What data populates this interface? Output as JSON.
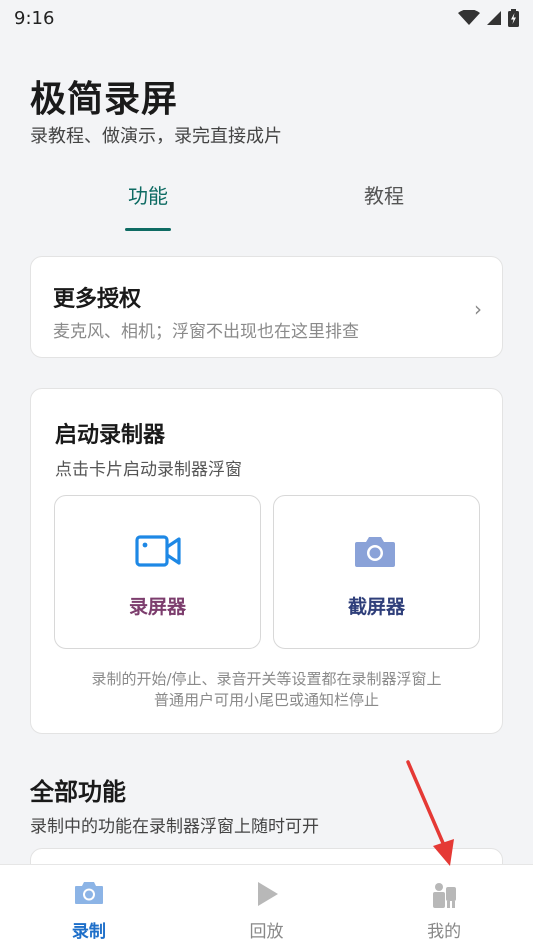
{
  "status_bar": {
    "time": "9:16"
  },
  "header": {
    "title": "极简录屏",
    "subtitle": "录教程、做演示，录完直接成片"
  },
  "tabs": [
    {
      "label": "功能",
      "active": true
    },
    {
      "label": "教程",
      "active": false
    }
  ],
  "permissions_card": {
    "title": "更多授权",
    "description": "麦克风、相机；浮窗不出现也在这里排查",
    "chevron": "›"
  },
  "launcher_card": {
    "title": "启动录制器",
    "description": "点击卡片启动录制器浮窗",
    "tools": [
      {
        "label": "录屏器",
        "icon": "video-camera-icon",
        "color": "#1e88e5"
      },
      {
        "label": "截屏器",
        "icon": "camera-icon",
        "color": "#8aa2d8"
      }
    ],
    "note_line1": "录制的开始/停止、录音开关等设置都在录制器浮窗上",
    "note_line2": "普通用户可用小尾巴或通知栏停止"
  },
  "all_features": {
    "title": "全部功能",
    "description": "录制中的功能在录制器浮窗上随时可开"
  },
  "bottom_nav": [
    {
      "label": "录制",
      "icon": "camera-icon",
      "active": true
    },
    {
      "label": "回放",
      "icon": "play-icon",
      "active": false
    },
    {
      "label": "我的",
      "icon": "profile-icon",
      "active": false
    }
  ],
  "colors": {
    "accent_tab": "#0e6b63",
    "accent_nav": "#1e6fc9",
    "annotation": "#e53935"
  }
}
